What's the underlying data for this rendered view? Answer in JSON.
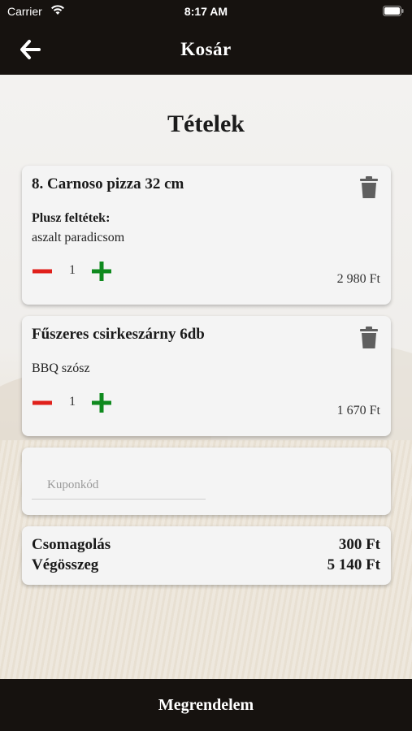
{
  "status_bar": {
    "carrier": "Carrier",
    "time": "8:17 AM"
  },
  "nav": {
    "title": "Kosár"
  },
  "heading": "Tételek",
  "items": [
    {
      "name": "8. Carnoso pizza 32 cm",
      "extras_label": "Plusz feltétek:",
      "extras": "aszalt paradicsom",
      "quantity": "1",
      "price": "2 980 Ft"
    },
    {
      "name": "Fűszeres csirkeszárny  6db",
      "extras": "BBQ szósz",
      "quantity": "1",
      "price": "1 670 Ft"
    }
  ],
  "coupon": {
    "placeholder": "Kuponkód",
    "value": ""
  },
  "summary": {
    "packaging_label": "Csomagolás",
    "packaging_value": "300 Ft",
    "total_label": "Végösszeg",
    "total_value": "5 140 Ft"
  },
  "order_button": "Megrendelem",
  "colors": {
    "bar": "#16120f",
    "minus": "#e0201b",
    "plus": "#0f8a1e",
    "trash": "#5f5f5f"
  }
}
